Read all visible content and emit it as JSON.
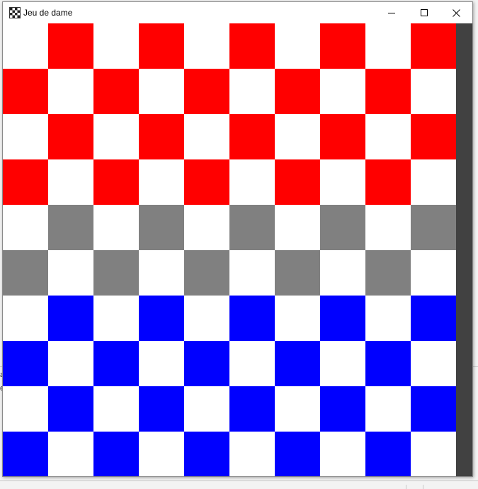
{
  "window": {
    "title": "Jeu de dame",
    "icon": "checkerboard-icon",
    "controls": {
      "minimize_icon": "minimize-icon",
      "maximize_icon": "maximize-icon",
      "close_icon": "close-icon"
    }
  },
  "board": {
    "rows": 10,
    "cols": 10,
    "first_square_light": true,
    "light_color": "#ffffff",
    "row_dark_colors": [
      "#ff0000",
      "#ff0000",
      "#ff0000",
      "#ff0000",
      "#808080",
      "#808080",
      "#0000ff",
      "#0000ff",
      "#0000ff",
      "#0000ff"
    ]
  },
  "background_app": {
    "partial_glyphs": [
      "a",
      "e"
    ]
  }
}
